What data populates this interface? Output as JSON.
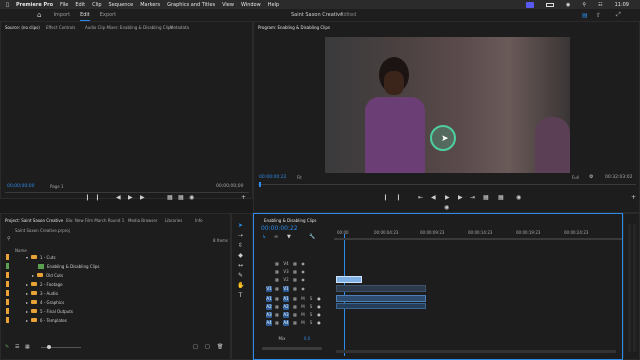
{
  "menubar": {
    "apple": "",
    "app": "Premiere Pro",
    "items": [
      "File",
      "Edit",
      "Clip",
      "Sequence",
      "Markers",
      "Graphics and Titles",
      "View",
      "Window",
      "Help"
    ],
    "time": "11:09"
  },
  "workspace": {
    "tabs": [
      "Import",
      "Edit",
      "Export"
    ],
    "active": "Edit",
    "project_title": "Saint Saxon Creative",
    "edited": "- Edited"
  },
  "source_panel": {
    "tabs": [
      "Source: (no clips)",
      "Effect Controls",
      "Audio Clip Mixer: Enabling & Disabling Clips",
      "Metadata"
    ],
    "tc_left": "00;00;00;00",
    "page": "Page 1",
    "tc_right": "00;00;00;00"
  },
  "program_panel": {
    "title": "Program: Enabling & Disabling Clips",
    "tc_left": "00:00:00:22",
    "fit": "Fit",
    "quality": "Full",
    "tc_right": "00:32:03:02"
  },
  "project_panel": {
    "tabs": [
      "Project: Saint Saxon Creative",
      "Bio: New Film March Round 1",
      "Media Browser",
      "Libraries",
      "Info"
    ],
    "file": "Saint Saxon Creative.prproj",
    "items_count": "8 Items",
    "col_name": "Name",
    "rows": [
      {
        "label": "1 - Cuts",
        "indent": 0,
        "type": "folder"
      },
      {
        "label": "Enabling & Disabling Clips",
        "indent": 2,
        "type": "sequence"
      },
      {
        "label": "Old Cuts",
        "indent": 1,
        "type": "folder"
      },
      {
        "label": "2 - Footage",
        "indent": 0,
        "type": "folder"
      },
      {
        "label": "3 - Audio",
        "indent": 0,
        "type": "folder"
      },
      {
        "label": "4 - Graphics",
        "indent": 0,
        "type": "folder"
      },
      {
        "label": "5 - Final Outputs",
        "indent": 0,
        "type": "folder"
      },
      {
        "label": "6 - Templates",
        "indent": 0,
        "type": "folder"
      }
    ]
  },
  "timeline": {
    "title": "Enabling & Disabling Clips",
    "tc": "00:00:00:22",
    "ruler": [
      "00:00",
      "00:00:04:23",
      "00:00:09:23",
      "00:00:14:23",
      "00:00:19:23",
      "00:00:24:23"
    ],
    "video_tracks": [
      "V4",
      "V3",
      "V2",
      "V1"
    ],
    "audio_tracks": [
      "A1",
      "A2",
      "A3",
      "A4"
    ],
    "mix": "Mix",
    "mix_val": "0.0"
  },
  "colors": {
    "accent": "#2d8ceb",
    "folder": "#e8a236",
    "clip_blue": "#6a9fd8",
    "audio_clip": "#4c7fb4"
  }
}
